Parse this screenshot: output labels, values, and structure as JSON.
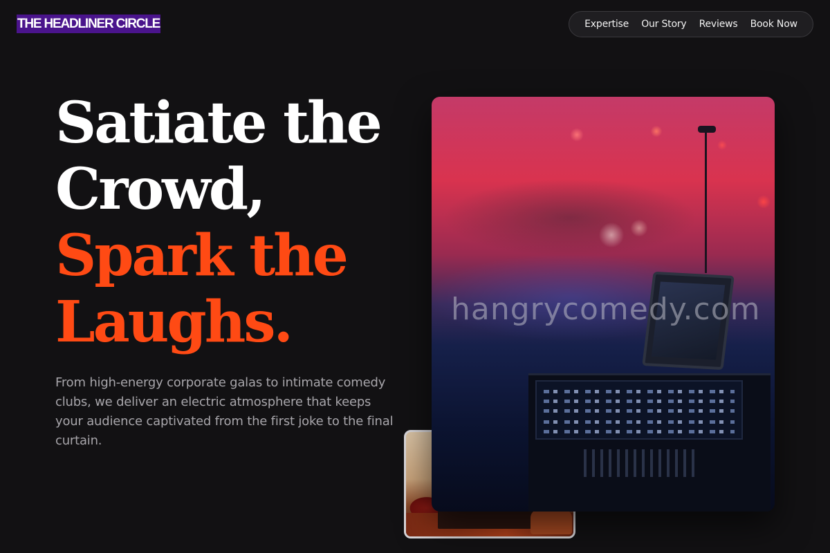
{
  "header": {
    "logo": "THE HEADLINER CIRCLE",
    "nav": [
      "Expertise",
      "Our Story",
      "Reviews",
      "Book Now"
    ]
  },
  "hero": {
    "headline_white": [
      "Satiate the",
      "Crowd,"
    ],
    "headline_orange": [
      "Spark the",
      "Laughs."
    ],
    "description": "From high-energy corporate galas to intimate comedy clubs, we deliver an electric atmosphere that keeps your audience captivated from the first joke to the final curtain."
  },
  "media": {
    "main_photo_watermark": "hangrycomedy.com"
  },
  "colors": {
    "background": "#121113",
    "accent": "#ff4a14",
    "logo_bg": "#4a148c"
  }
}
